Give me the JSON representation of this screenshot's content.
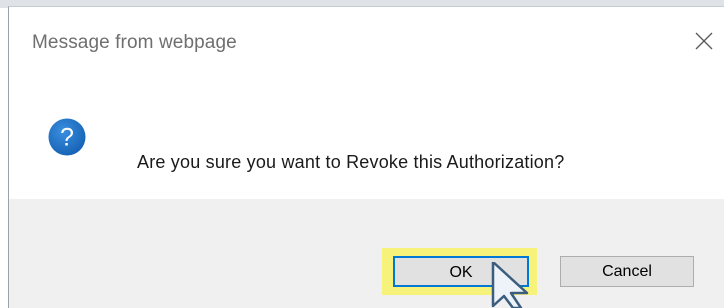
{
  "dialog": {
    "title": "Message from webpage",
    "close_icon": "close-icon",
    "question_icon": "question-icon",
    "message": "Are you sure you want to Revoke this Authorization?"
  },
  "buttons": {
    "ok_label": "OK",
    "cancel_label": "Cancel"
  },
  "colors": {
    "highlight": "#f7f27a",
    "focus_border": "#0078d7",
    "icon_blue": "#1b6fc0",
    "footer_bg": "#f0f0f0"
  }
}
